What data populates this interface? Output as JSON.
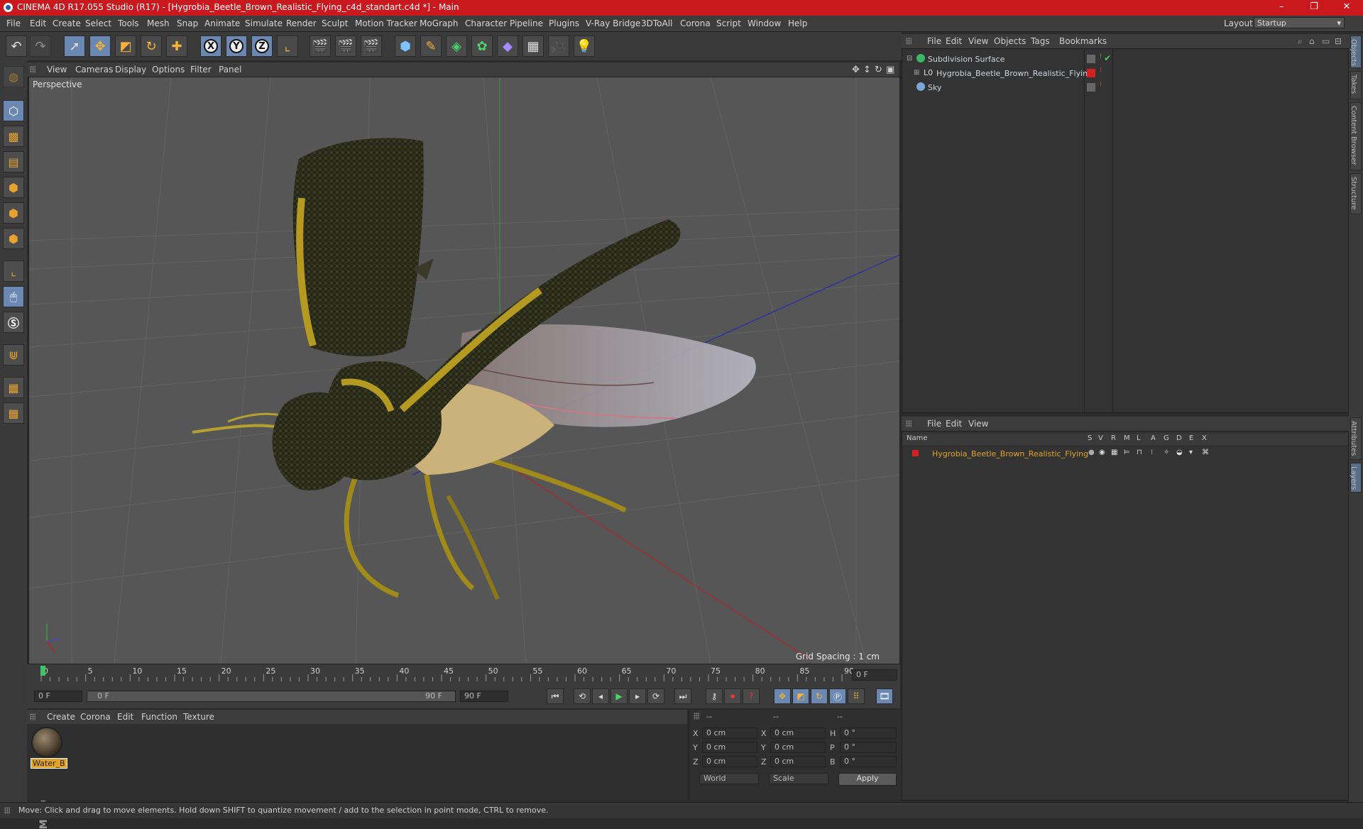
{
  "window": {
    "title": "CINEMA 4D R17.055 Studio (R17) - [Hygrobia_Beetle_Brown_Realistic_Flying_c4d_standart.c4d *] - Main",
    "minimize": "–",
    "maximize": "❐",
    "close": "✕"
  },
  "menu": [
    "File",
    "Edit",
    "Create",
    "Select",
    "Tools",
    "Mesh",
    "Snap",
    "Animate",
    "Simulate",
    "Render",
    "Sculpt",
    "Motion Tracker",
    "MoGraph",
    "Character",
    "Pipeline",
    "Plugins",
    "V-Ray Bridge",
    "3DToAll",
    "Corona",
    "Script",
    "Window",
    "Help"
  ],
  "layout": {
    "label": "Layout:",
    "value": "Startup"
  },
  "toolbar": {
    "x": "X",
    "y": "Y",
    "z": "Z"
  },
  "viewport": {
    "menu": [
      "View",
      "Cameras",
      "Display",
      "Options",
      "Filter",
      "Panel"
    ],
    "label": "Perspective",
    "grid_spacing": "Grid Spacing : 1 cm"
  },
  "timeline": {
    "ticks": [
      "0",
      "5",
      "10",
      "15",
      "20",
      "25",
      "30",
      "35",
      "40",
      "45",
      "50",
      "55",
      "60",
      "65",
      "70",
      "75",
      "80",
      "85",
      "90"
    ],
    "current_frame": "0 F",
    "start": "0 F",
    "range_start": "0 F",
    "range_end": "90 F",
    "end": "90 F"
  },
  "material_manager": {
    "menu": [
      "Create",
      "Corona",
      "Edit",
      "Function",
      "Texture"
    ],
    "material_name": "Water_B"
  },
  "coordinates": {
    "headers": [
      "--",
      "--",
      "--"
    ],
    "rows": [
      {
        "a": "X",
        "av": "0 cm",
        "b": "X",
        "bv": "0 cm",
        "c": "H",
        "cv": "0 °"
      },
      {
        "a": "Y",
        "av": "0 cm",
        "b": "Y",
        "bv": "0 cm",
        "c": "P",
        "cv": "0 °"
      },
      {
        "a": "Z",
        "av": "0 cm",
        "b": "Z",
        "bv": "0 cm",
        "c": "B",
        "cv": "0 °"
      }
    ],
    "mode1": "World",
    "mode2": "Scale",
    "apply": "Apply"
  },
  "status": "Move: Click and drag to move elements. Hold down SHIFT to quantize movement / add to the selection in point mode, CTRL to remove.",
  "object_manager": {
    "menu": [
      "File",
      "Edit",
      "View",
      "Objects",
      "Tags",
      "Bookmarks"
    ],
    "objects": [
      "Subdivision Surface",
      "Hygrobia_Beetle_Brown_Realistic_Flying",
      "Sky"
    ]
  },
  "layer_manager": {
    "menu": [
      "File",
      "Edit",
      "View"
    ],
    "columns": [
      "Name",
      "S",
      "V",
      "R",
      "M",
      "L",
      "A",
      "G",
      "D",
      "E",
      "X"
    ],
    "layer": "Hygrobia_Beetle_Brown_Realistic_Flying"
  },
  "right_tabs": [
    "Objects",
    "Takes",
    "Content Browser",
    "Structure",
    "Attributes",
    "Layers"
  ],
  "colors": {
    "title_bar": "#c9181e",
    "accent_orange": "#e3a32a",
    "selected_blue": "#6a88b2",
    "layer_red": "#d42020"
  }
}
